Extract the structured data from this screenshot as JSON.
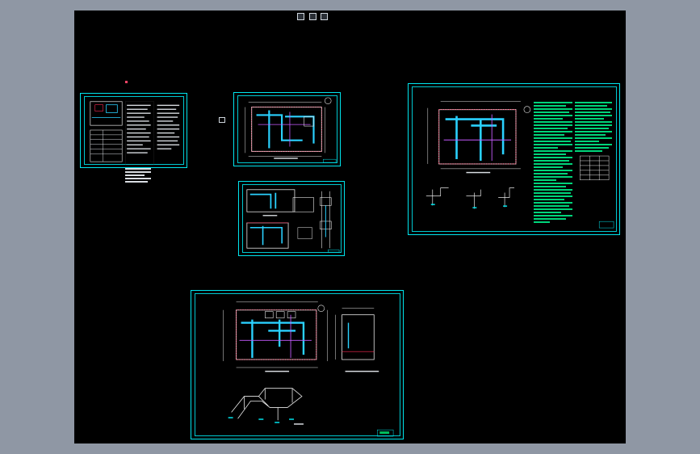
{
  "app": {
    "background_color": "#8f97a4",
    "canvas_color": "#000000",
    "frame_color": "#00e5ee",
    "wall_color": "#e8e8e8",
    "duct_color": "#2ad1ff",
    "accent_red": "#ff2a55",
    "note_color": "#00d47a"
  },
  "stamps": [
    "",
    "",
    ""
  ],
  "sheets": [
    {
      "id": "sheet-1",
      "label": ""
    },
    {
      "id": "sheet-2",
      "label": ""
    },
    {
      "id": "sheet-3",
      "label": ""
    },
    {
      "id": "sheet-4",
      "label": ""
    },
    {
      "id": "sheet-5",
      "label": ""
    }
  ]
}
